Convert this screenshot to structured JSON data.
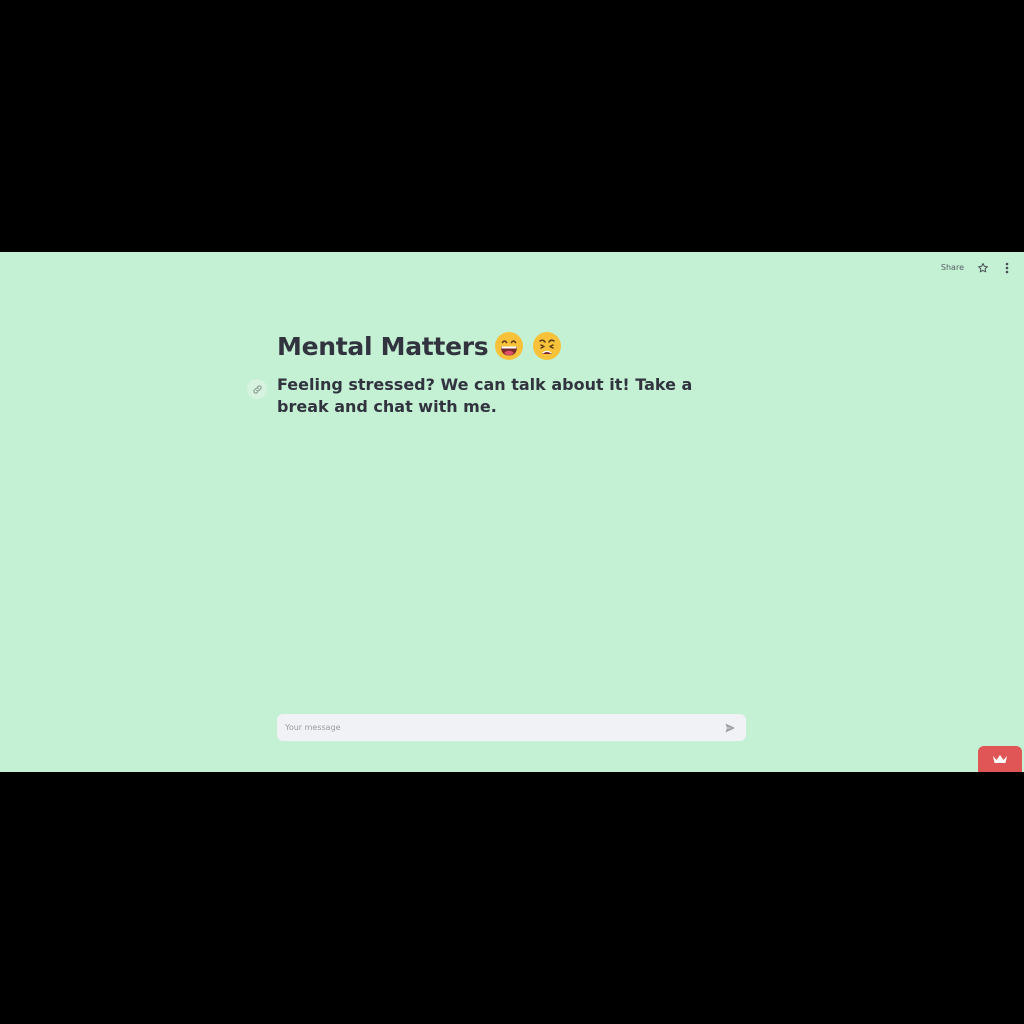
{
  "toolbar": {
    "share_label": "Share",
    "star_icon": "star-icon",
    "menu_icon": "kebab-menu-icon"
  },
  "main": {
    "title": "Mental Matters",
    "title_emojis": [
      "grinning-face-emoji",
      "tired-face-emoji"
    ],
    "subtitle": "Feeling stressed? We can talk about it! Take a break and chat with me.",
    "anchor_icon": "link-icon"
  },
  "chat": {
    "placeholder": "Your message",
    "value": "",
    "send_icon": "send-icon"
  },
  "badge": {
    "icon": "crown-icon"
  },
  "colors": {
    "background": "#c4f0d3",
    "text": "#31333f",
    "input_bg": "#f0f2f6",
    "badge": "#e05656"
  }
}
